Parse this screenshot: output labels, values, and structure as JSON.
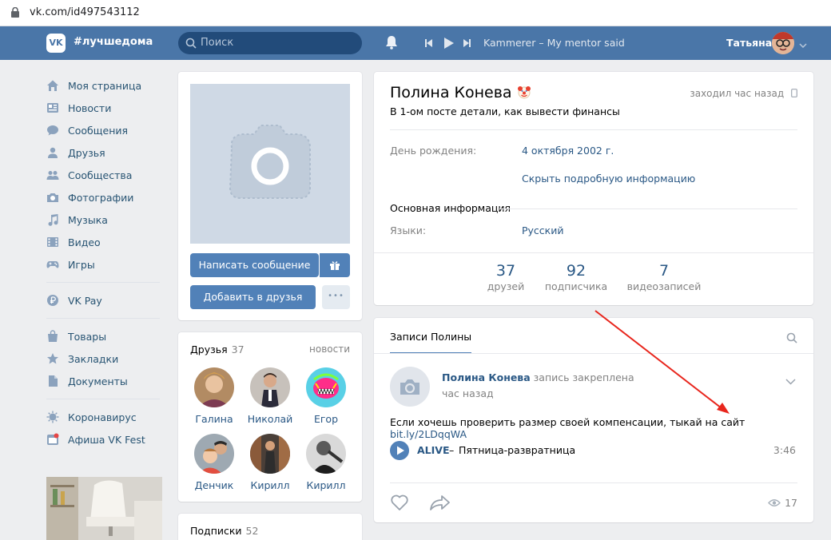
{
  "browser": {
    "url": "vk.com/id497543112"
  },
  "header": {
    "logo": "VK",
    "hashtag": "#лучшедома",
    "search_placeholder": "Поиск",
    "track": "Kammerer – My mentor said",
    "user_name": "Татьяна"
  },
  "left_menu": {
    "items": [
      {
        "label": "Моя страница",
        "icon": "home-icon"
      },
      {
        "label": "Новости",
        "icon": "news-icon"
      },
      {
        "label": "Сообщения",
        "icon": "messages-icon"
      },
      {
        "label": "Друзья",
        "icon": "friends-icon"
      },
      {
        "label": "Сообщества",
        "icon": "groups-icon"
      },
      {
        "label": "Фотографии",
        "icon": "camera-icon"
      },
      {
        "label": "Музыка",
        "icon": "music-icon"
      },
      {
        "label": "Видео",
        "icon": "video-icon"
      },
      {
        "label": "Игры",
        "icon": "gamepad-icon"
      }
    ],
    "pay": {
      "label": "VK Pay",
      "icon": "ruble-icon"
    },
    "extra": [
      {
        "label": "Товары",
        "icon": "bag-icon"
      },
      {
        "label": "Закладки",
        "icon": "star-icon"
      },
      {
        "label": "Документы",
        "icon": "document-icon"
      }
    ],
    "promo": [
      {
        "label": "Коронавирус",
        "icon": "virus-icon"
      },
      {
        "label": "Афиша VK Fest",
        "icon": "calendar-icon"
      }
    ]
  },
  "profile_actions": {
    "message_btn": "Написать сообщение",
    "add_friend_btn": "Добавить в друзья",
    "more": "•••"
  },
  "friends": {
    "title": "Друзья",
    "count": "37",
    "updates": "новости",
    "list": [
      {
        "name": "Галина",
        "color": "#c89a6a"
      },
      {
        "name": "Николай",
        "color": "#8f7b70"
      },
      {
        "name": "Егор",
        "color": "#6ad2e8"
      },
      {
        "name": "Денчик",
        "color": "#a7b0b8"
      },
      {
        "name": "Кирилл",
        "color": "#6f6257"
      },
      {
        "name": "Кирилл",
        "color": "#3a3a3a"
      }
    ]
  },
  "subscriptions": {
    "title": "Подписки",
    "count": "52"
  },
  "profile": {
    "name": "Полина Конева",
    "status": "В 1-ом посте детали, как вывести финансы",
    "online": "заходил час назад",
    "birthday_label": "День рождения:",
    "birthday_value": "4 октября 2002 г.",
    "toggle_details": "Скрыть подробную информацию",
    "main_info": "Основная информация",
    "languages_label": "Языки:",
    "languages_value": "Русский",
    "counters": [
      {
        "num": "37",
        "label": "друзей"
      },
      {
        "num": "92",
        "label": "подписчика"
      },
      {
        "num": "7",
        "label": "видеозаписей"
      }
    ]
  },
  "wall": {
    "tab": "Записи Полины",
    "post": {
      "author": "Полина Конева",
      "pinned": "запись закреплена",
      "time": "час назад",
      "text": "Если хочешь проверить размер своей компенсации, тыкай на сайт ",
      "link": "bit.ly/2LDqqWA",
      "audio_artist": "ALIVE",
      "audio_dash": "–",
      "audio_title": "Пятница-развратница",
      "audio_duration": "3:46",
      "views": "17"
    }
  },
  "colors": {
    "header": "#4a76a8",
    "accent": "#5181b8",
    "link": "#2a5885",
    "arrow": "#e8261d"
  }
}
